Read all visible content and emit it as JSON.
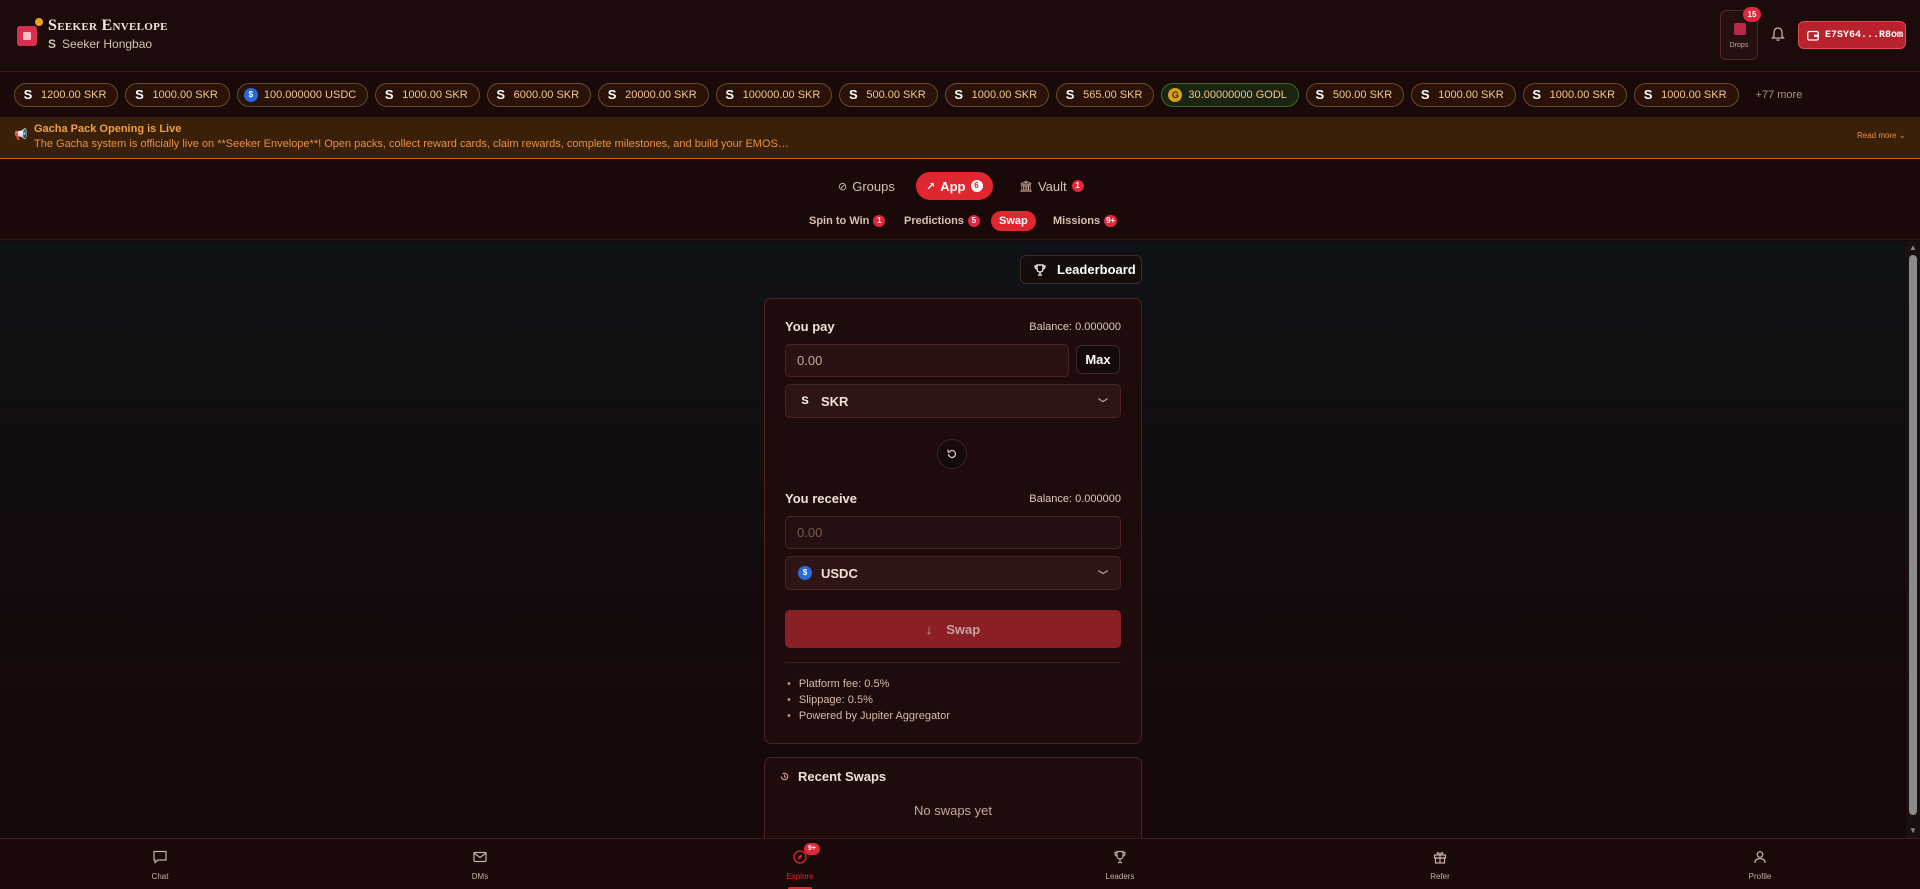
{
  "header": {
    "app_title": "Seeker Envelope",
    "app_subtitle_icon": "S",
    "app_subtitle": "Seeker Hongbao",
    "drops_label": "Drops",
    "drops_badge": "15",
    "wallet_address": "E7SY64...R8om"
  },
  "chips": [
    {
      "icon": "S",
      "kind": "skr",
      "label": "1200.00 SKR"
    },
    {
      "icon": "S",
      "kind": "skr",
      "label": "1000.00 SKR"
    },
    {
      "icon": "$",
      "kind": "usdc",
      "label": "100.000000 USDC"
    },
    {
      "icon": "S",
      "kind": "skr",
      "label": "1000.00 SKR"
    },
    {
      "icon": "S",
      "kind": "skr",
      "label": "6000.00 SKR"
    },
    {
      "icon": "S",
      "kind": "skr",
      "label": "20000.00 SKR"
    },
    {
      "icon": "S",
      "kind": "skr",
      "label": "100000.00 SKR"
    },
    {
      "icon": "S",
      "kind": "skr",
      "label": "500.00 SKR"
    },
    {
      "icon": "S",
      "kind": "skr",
      "label": "1000.00 SKR"
    },
    {
      "icon": "S",
      "kind": "skr",
      "label": "565.00 SKR"
    },
    {
      "icon": "G",
      "kind": "godl",
      "label": "30.00000000 GODL"
    },
    {
      "icon": "S",
      "kind": "skr",
      "label": "500.00 SKR"
    },
    {
      "icon": "S",
      "kind": "skr",
      "label": "1000.00 SKR"
    },
    {
      "icon": "S",
      "kind": "skr",
      "label": "1000.00 SKR"
    },
    {
      "icon": "S",
      "kind": "skr",
      "label": "1000.00 SKR"
    }
  ],
  "chips_more": "+77 more",
  "announcement": {
    "title": "Gacha Pack Opening is Live",
    "body": "The Gacha system is officially live on **Seeker Envelope**! Open packs, collect reward cards, claim rewards, complete milestones, and build your EMOS…",
    "read_more": "Read more"
  },
  "main_tabs": [
    {
      "label": "Groups",
      "badge": ""
    },
    {
      "label": "App",
      "badge": "6"
    },
    {
      "label": "Vault",
      "badge": "1"
    }
  ],
  "sub_tabs": [
    {
      "label": "Spin to Win",
      "badge": "1"
    },
    {
      "label": "Predictions",
      "badge": "5"
    },
    {
      "label": "Swap",
      "badge": ""
    },
    {
      "label": "Missions",
      "badge": "9+"
    }
  ],
  "leaderboard_label": "Leaderboard",
  "swap": {
    "pay_label": "You pay",
    "pay_balance": "Balance: 0.000000",
    "pay_amount_placeholder": "0.00",
    "max_label": "Max",
    "pay_token": "SKR",
    "receive_label": "You receive",
    "receive_balance": "Balance: 0.000000",
    "receive_amount_placeholder": "0.00",
    "receive_token": "USDC",
    "swap_button": "Swap",
    "info": [
      "Platform fee: 0.5%",
      "Slippage: 0.5%",
      "Powered by Jupiter Aggregator"
    ]
  },
  "recent_swaps": {
    "title": "Recent Swaps",
    "empty": "No swaps yet"
  },
  "bottom_nav": [
    {
      "label": "Chat",
      "badge": ""
    },
    {
      "label": "DMs",
      "badge": ""
    },
    {
      "label": "Explore",
      "badge": "9+"
    },
    {
      "label": "Leaders",
      "badge": ""
    },
    {
      "label": "Refer",
      "badge": ""
    },
    {
      "label": "Profile",
      "badge": ""
    }
  ],
  "colors": {
    "accent": "#e0262e",
    "background": "#160808",
    "announcement_bg": "#3a2008",
    "chip_text": "#f0c890"
  }
}
